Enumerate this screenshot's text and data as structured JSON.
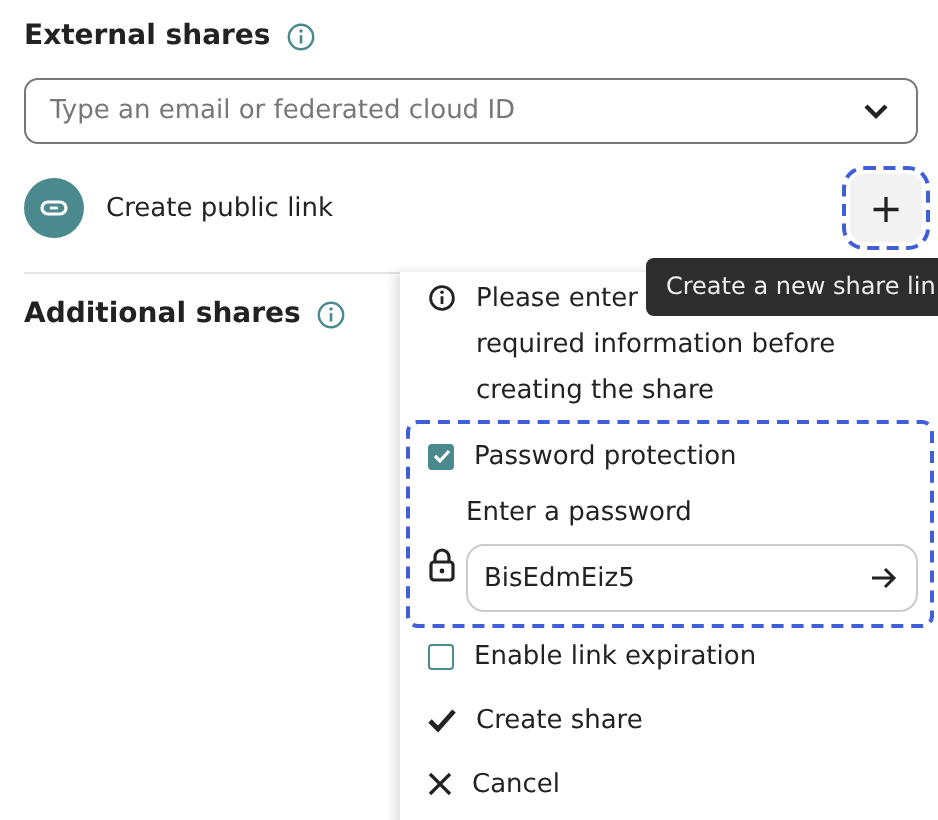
{
  "external_shares": {
    "title": "External shares",
    "search": {
      "placeholder": "Type an email or federated cloud ID"
    },
    "public_link": {
      "label": "Create public link"
    },
    "add_button": {
      "label": "+",
      "focused": true
    },
    "tooltip": "Create a new share lin"
  },
  "additional_shares": {
    "title": "Additional shares"
  },
  "menu": {
    "info_lines": [
      "Please enter",
      "required information before",
      "creating the share"
    ],
    "password_protection": {
      "label": "Password protection",
      "checked": true,
      "focused": true
    },
    "password": {
      "label": "Enter a password",
      "value": "BisEdmEiz5"
    },
    "items": [
      {
        "kind": "checkbox",
        "label": "Enable link expiration",
        "checked": false
      },
      {
        "kind": "confirm",
        "label": "Create share"
      },
      {
        "kind": "cancel",
        "label": "Cancel"
      }
    ]
  }
}
